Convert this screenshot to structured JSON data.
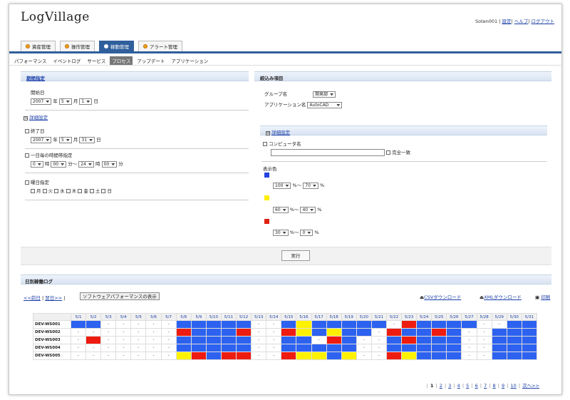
{
  "logo": "LogVillage",
  "user": {
    "name": "Soten001",
    "links": [
      "設定",
      "ヘルプ",
      "ログアウト"
    ]
  },
  "tabs": [
    "資産管理",
    "操作管理",
    "稼動管理",
    "アラート管理"
  ],
  "active_tab": 2,
  "subnav": [
    "パフォーマンス",
    "イベントログ",
    "サービス",
    "プロセス",
    "アップデート",
    "アプリケーション"
  ],
  "active_subnav": 3,
  "left": {
    "head": "期間指定",
    "start_label": "開始日",
    "start": {
      "year": "2007",
      "month": "5",
      "day": "1"
    },
    "year_unit": "年",
    "month_unit": "月",
    "day_unit": "日",
    "detail": "詳細設定",
    "end_label": "終了日",
    "end": {
      "year": "2007",
      "month": "5",
      "day": "31"
    },
    "daily_label": "一日毎の時間帯指定",
    "time": {
      "h1": "0",
      "m1": "00",
      "h2": "24",
      "m2": "00"
    },
    "hour_unit": "時",
    "min_unit": "分～",
    "min_unit2": "分",
    "weekday_label": "曜日指定",
    "weekdays": [
      "月",
      "火",
      "水",
      "木",
      "金",
      "土",
      "日"
    ]
  },
  "right": {
    "head": "絞込み項目",
    "group_label": "グループ名",
    "group_value": "開発部",
    "app_label": "アプリケーション名",
    "app_value": "AutoCAD",
    "detail": "詳細設定",
    "computer_label": "コンピュータ名",
    "computer_value": "",
    "exact_label": "完全一致",
    "color_label": "表示色",
    "ranges": [
      {
        "color": "#2244e0",
        "from": "100",
        "to": "70"
      },
      {
        "color": "#ffee00",
        "from": "60",
        "to": "40"
      },
      {
        "color": "#e02010",
        "from": "30",
        "to": "0"
      }
    ],
    "pct_sep": "%～",
    "pct": "%"
  },
  "run_button": "実行",
  "log": {
    "head": "日別稼働ログ",
    "prev": "<<前日",
    "next": "翌日>>",
    "toggle": "ソフトウェアパフォーマンスの表示",
    "csv": "CSVダウンロード",
    "xml": "XMLダウンロード",
    "print": "印刷",
    "dates": [
      "5/1",
      "5/2",
      "5/3",
      "5/4",
      "5/5",
      "5/6",
      "5/7",
      "5/8",
      "5/9",
      "5/10",
      "5/11",
      "5/12",
      "5/13",
      "5/14",
      "5/15",
      "5/16",
      "5/17",
      "5/18",
      "5/19",
      "5/20",
      "5/21",
      "5/22",
      "5/23",
      "5/24",
      "5/25",
      "5/26",
      "5/27",
      "5/28",
      "5/29",
      "5/30",
      "5/31"
    ],
    "rows": [
      {
        "name": "DEV-WS001",
        "cells": "BB-----BBBBB--BYBBBBB-RBBBB--BBYB"
      },
      {
        "name": "DEV-WS002",
        "cells": "-------RBBBR--RYBYBB-RBBRB--BBBR"
      },
      {
        "name": "DEV-WS003",
        "cells": "-R-----BBBBB--BB-RB--BRBBB--BBBB"
      },
      {
        "name": "DEV-WS004",
        "cells": "-------BBBBB--BBBBB--BBBBB--BBBB"
      },
      {
        "name": "DEV-WS005",
        "cells": "-------YRBRR--RYYBY--RYBBB--BBBB"
      }
    ],
    "pager": [
      "1",
      "2",
      "3",
      "4",
      "5",
      "6",
      "7",
      "8",
      "9",
      "10"
    ],
    "pager_next": "次へ>>"
  }
}
